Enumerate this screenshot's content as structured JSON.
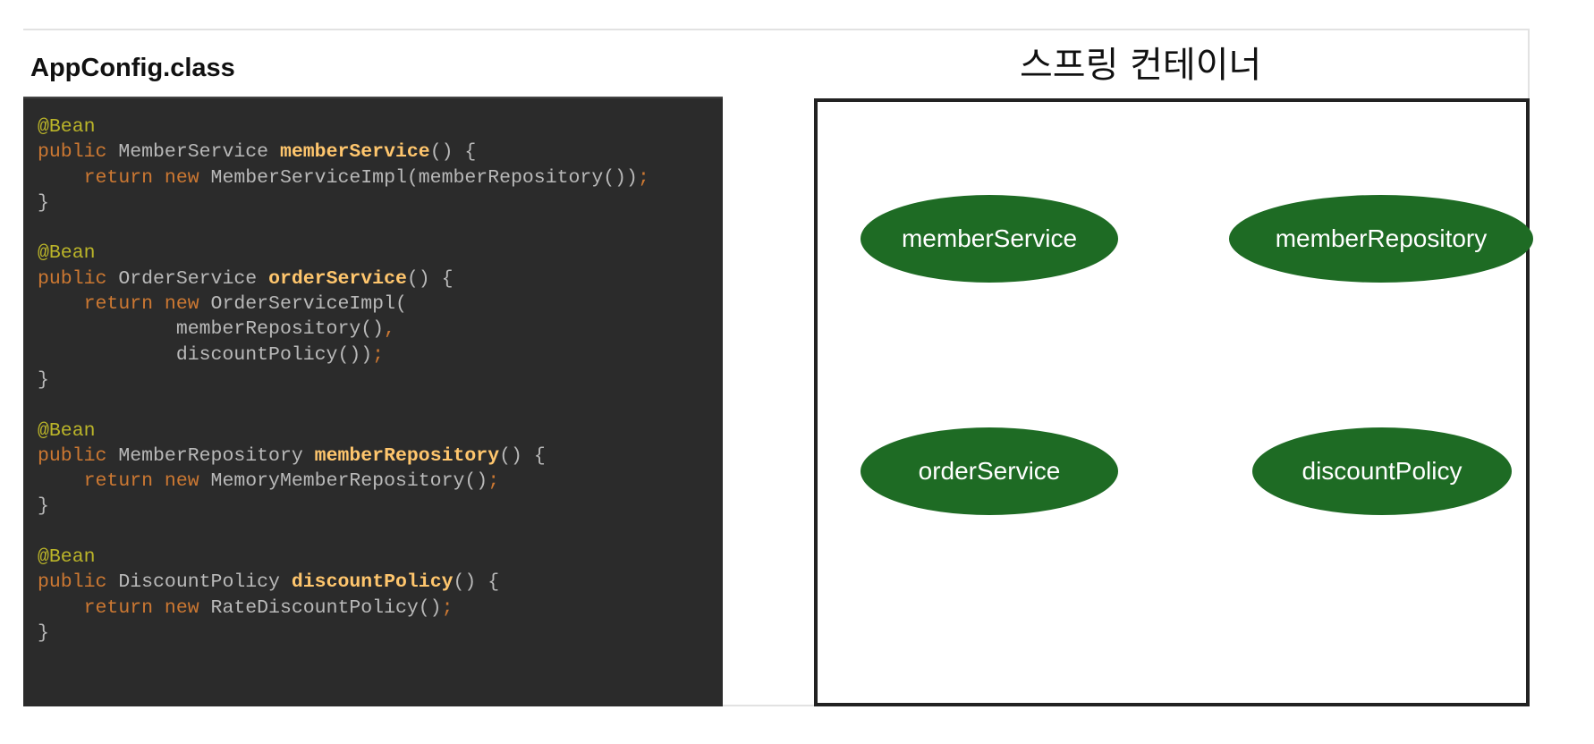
{
  "file_title": "AppConfig.class",
  "container_title": "스프링 컨테이너",
  "code_lines": [
    [
      {
        "t": "@Bean",
        "c": "ann"
      }
    ],
    [
      {
        "t": "public ",
        "c": "kw"
      },
      {
        "t": "MemberService ",
        "c": "plain"
      },
      {
        "t": "memberService",
        "c": "fn"
      },
      {
        "t": "() {",
        "c": "plain"
      }
    ],
    [
      {
        "t": "    return new ",
        "c": "kw"
      },
      {
        "t": "MemberServiceImpl(memberRepository())",
        "c": "plain"
      },
      {
        "t": ";",
        "c": "kw"
      }
    ],
    [
      {
        "t": "}",
        "c": "plain"
      }
    ],
    [],
    [
      {
        "t": "@Bean",
        "c": "ann"
      }
    ],
    [
      {
        "t": "public ",
        "c": "kw"
      },
      {
        "t": "OrderService ",
        "c": "plain"
      },
      {
        "t": "orderService",
        "c": "fn"
      },
      {
        "t": "() {",
        "c": "plain"
      }
    ],
    [
      {
        "t": "    return new ",
        "c": "kw"
      },
      {
        "t": "OrderServiceImpl(",
        "c": "plain"
      }
    ],
    [
      {
        "t": "            memberRepository()",
        "c": "plain"
      },
      {
        "t": ",",
        "c": "kw"
      }
    ],
    [
      {
        "t": "            discountPolicy())",
        "c": "plain"
      },
      {
        "t": ";",
        "c": "kw"
      }
    ],
    [
      {
        "t": "}",
        "c": "plain"
      }
    ],
    [],
    [
      {
        "t": "@Bean",
        "c": "ann"
      }
    ],
    [
      {
        "t": "public ",
        "c": "kw"
      },
      {
        "t": "MemberRepository ",
        "c": "plain"
      },
      {
        "t": "memberRepository",
        "c": "fn"
      },
      {
        "t": "() {",
        "c": "plain"
      }
    ],
    [
      {
        "t": "    return new ",
        "c": "kw"
      },
      {
        "t": "MemoryMemberRepository()",
        "c": "plain"
      },
      {
        "t": ";",
        "c": "kw"
      }
    ],
    [
      {
        "t": "}",
        "c": "plain"
      }
    ],
    [],
    [
      {
        "t": "@Bean",
        "c": "ann"
      }
    ],
    [
      {
        "t": "public ",
        "c": "kw"
      },
      {
        "t": "DiscountPolicy ",
        "c": "plain"
      },
      {
        "t": "discountPolicy",
        "c": "fn"
      },
      {
        "t": "() {",
        "c": "plain"
      }
    ],
    [
      {
        "t": "    return new ",
        "c": "kw"
      },
      {
        "t": "RateDiscountPolicy()",
        "c": "plain"
      },
      {
        "t": ";",
        "c": "kw"
      }
    ],
    [
      {
        "t": "}",
        "c": "plain"
      }
    ]
  ],
  "beans": {
    "member_service": "memberService",
    "member_repository": "memberRepository",
    "order_service": "orderService",
    "discount_policy": "discountPolicy"
  },
  "colors": {
    "code_background": "#2b2b2b",
    "annotation": "#bbb529",
    "keyword": "#cc7832",
    "method_name": "#ffc66d",
    "bean_fill": "#1e6b24"
  }
}
